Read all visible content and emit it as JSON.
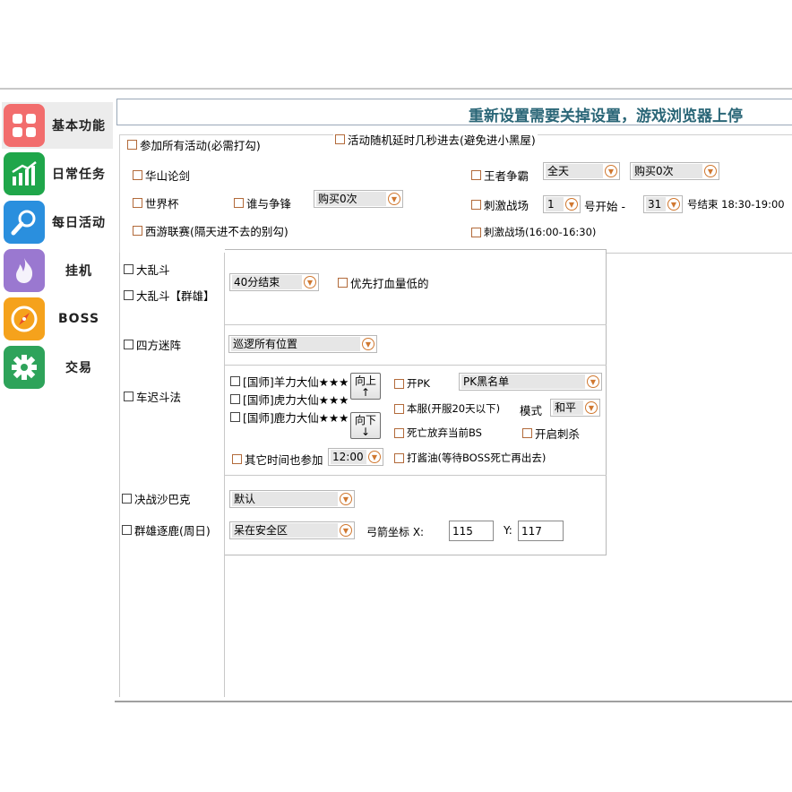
{
  "title": "重新设置需要关掉设置，游戏浏览器上停",
  "sidebar": {
    "items": [
      {
        "label": "基本功能",
        "icon": "grid-icon",
        "color": "#f26d6d"
      },
      {
        "label": "日常任务",
        "icon": "chart-icon",
        "color": "#1fa64a"
      },
      {
        "label": "每日活动",
        "icon": "magnifier-icon",
        "color": "#2a8fde"
      },
      {
        "label": "挂机",
        "icon": "flame-icon",
        "color": "#9a78d0"
      },
      {
        "label": "BOSS",
        "icon": "compass-icon",
        "color": "#f5a21c"
      },
      {
        "label": "交易",
        "icon": "gear-icon",
        "color": "#2ea35a"
      }
    ]
  },
  "top": {
    "join_all": "参加所有活动(必需打勾)",
    "random_delay": "活动随机延时几秒进去(避免进小黑屋)",
    "huashan": "华山论剑",
    "world_cup": "世界杯",
    "who_compete": "谁与争锋",
    "buy_select": "购买0次",
    "xiyou": "西游联赛(隔天进不去的别勾)",
    "king": "王者争霸",
    "king_time": "全天",
    "king_buy": "购买0次",
    "thrill": "刺激战场",
    "thrill_start": "1",
    "start_label": "号开始 -",
    "thrill_end": "31",
    "end_label": "号结束 18:30-19:00",
    "thrill2": "刺激战场(16:00-16:30)"
  },
  "left_list": {
    "brawl": "大乱斗",
    "brawl_hero": "大乱斗【群雄】",
    "maze": "四方迷阵",
    "chechi": "车迟斗法",
    "shabak": "决战沙巴克",
    "deer": "群雄逐鹿(周日)"
  },
  "brawl_section": {
    "end_select": "40分结束",
    "low_hp": "优先打血量低的"
  },
  "maze_section": {
    "patrol_select": "巡逻所有位置"
  },
  "chechi_section": {
    "masters": [
      "[国师]羊力大仙★★★",
      "[国师]虎力大仙★★★",
      "[国师]鹿力大仙★★★"
    ],
    "up_button": "向上",
    "up_arrow": "↑",
    "down_button": "向下",
    "down_arrow": "↓",
    "open_pk": "开PK",
    "pk_list": "PK黑名单",
    "this_server": "本服(开服20天以下)",
    "mode_label": "模式",
    "mode_select": "和平",
    "death_quit": "死亡放弃当前BS",
    "open_kill": "开启刺杀",
    "other_time": "其它时间也参加",
    "time_select": "12:00",
    "soy": "打酱油(等待BOSS死亡再出去)"
  },
  "bottom_section": {
    "default_select": "默认",
    "safe_select": "呆在安全区",
    "coord_label": "弓箭坐标 X:",
    "x_value": "115",
    "y_label": "Y:",
    "y_value": "117"
  }
}
